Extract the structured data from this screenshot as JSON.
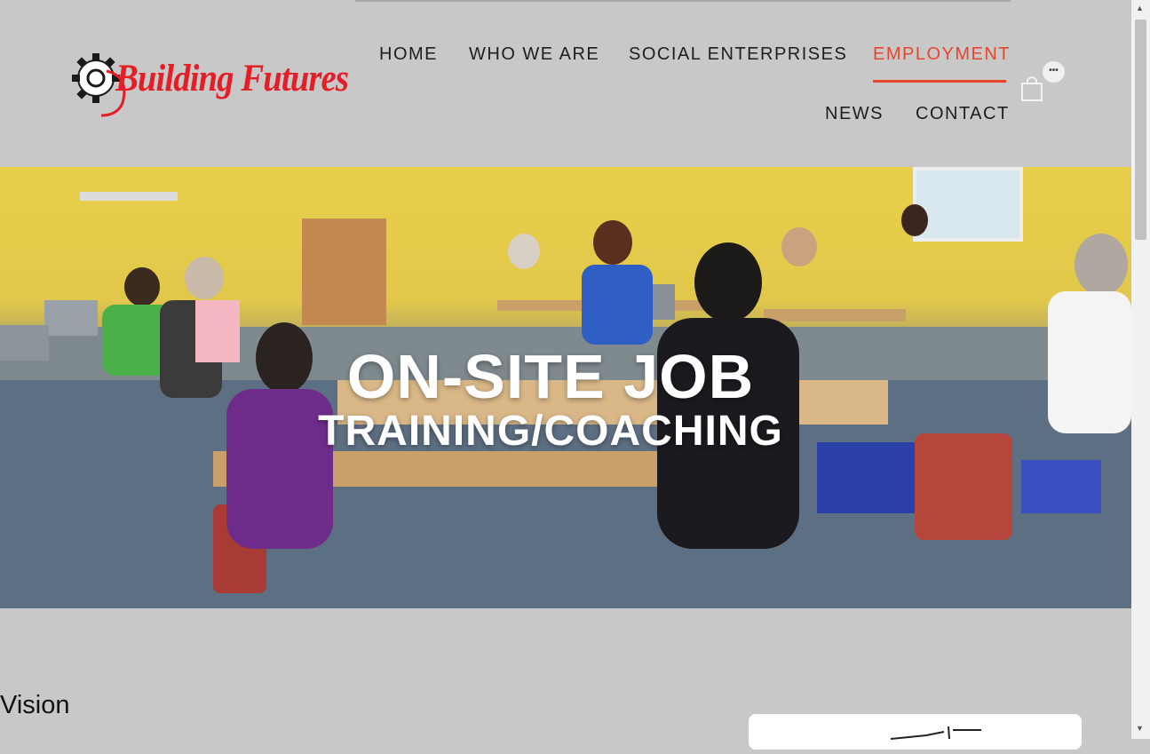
{
  "brand": {
    "logo_text": "Building Futures",
    "color": "#e41e26"
  },
  "nav": {
    "items": [
      {
        "label": "HOME"
      },
      {
        "label": "WHO WE ARE"
      },
      {
        "label": "SOCIAL ENTERPRISES"
      },
      {
        "label": "EMPLOYMENT",
        "active": true
      },
      {
        "label": "NEWS"
      },
      {
        "label": "CONTACT"
      }
    ],
    "active_color": "#e8452a",
    "cart_badge": "•••",
    "cart_icon": "shopping-bag-icon"
  },
  "hero": {
    "title_line1": "ON-SITE JOB",
    "title_line2": "TRAINING/COACHING"
  },
  "content": {
    "heading": "Vision"
  }
}
